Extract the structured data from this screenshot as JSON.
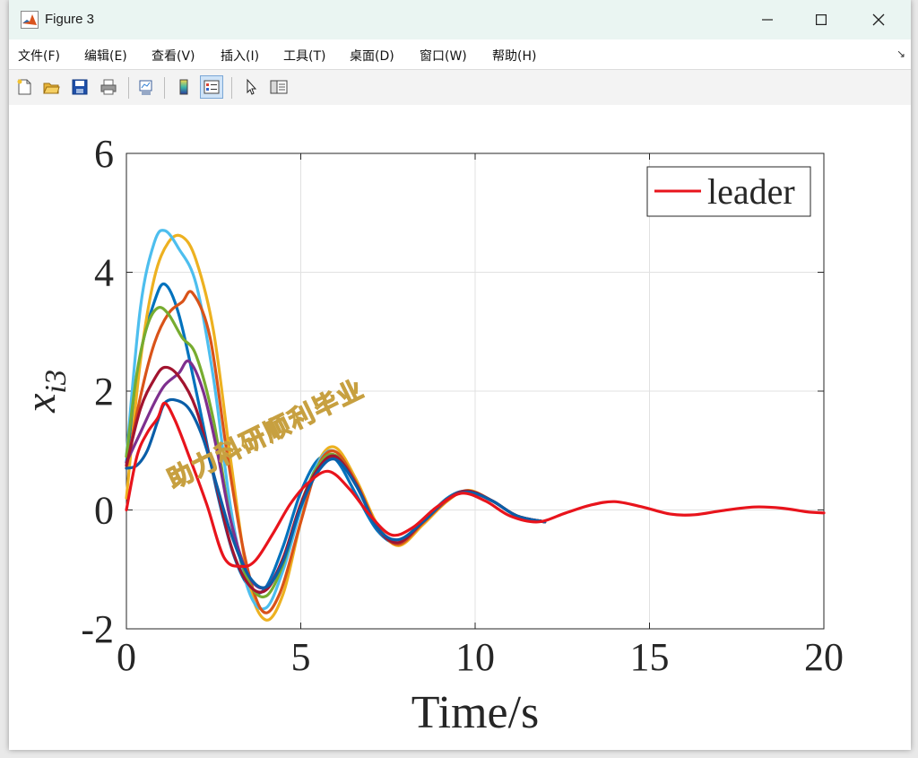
{
  "window": {
    "title": "Figure 3"
  },
  "menu": [
    {
      "label": "文件(F)"
    },
    {
      "label": "编辑(E)"
    },
    {
      "label": "查看(V)"
    },
    {
      "label": "插入(I)"
    },
    {
      "label": "工具(T)"
    },
    {
      "label": "桌面(D)"
    },
    {
      "label": "窗口(W)"
    },
    {
      "label": "帮助(H)"
    }
  ],
  "toolbar_icons": [
    "new-figure-icon",
    "open-file-icon",
    "save-icon",
    "print-icon",
    "link-plot-icon",
    "colorbar-icon",
    "legend-icon",
    "pointer-icon",
    "property-inspector-icon"
  ],
  "watermark": "助力科研顺利毕业",
  "chart_data": {
    "type": "line",
    "xlabel": "Time/s",
    "ylabel": "x_i3",
    "xlim": [
      0,
      20
    ],
    "ylim": [
      -2,
      6
    ],
    "xticks": [
      "0",
      "5",
      "10",
      "15",
      "20"
    ],
    "yticks": [
      "-2",
      "0",
      "2",
      "4",
      "6"
    ],
    "grid": true,
    "legend": {
      "position": "top-right",
      "entries": [
        "leader"
      ]
    },
    "series": [
      {
        "name": "leader",
        "color": "#e8141c",
        "x": [
          0,
          0.3,
          0.6,
          0.9,
          1.1,
          1.4,
          1.8,
          2.3,
          2.8,
          3.3,
          3.7,
          4.2,
          4.7,
          5.2,
          5.8,
          6.4,
          7.0,
          7.6,
          8.2,
          8.9,
          9.6,
          10.3,
          11.0,
          11.8,
          12.6,
          13.3,
          14.0,
          14.8,
          15.6,
          16.3,
          17.1,
          18.0,
          18.8,
          19.5,
          20
        ],
        "y": [
          0.0,
          0.9,
          1.3,
          1.55,
          1.8,
          1.5,
          0.9,
          0.1,
          -0.8,
          -0.95,
          -0.85,
          -0.4,
          0.1,
          0.45,
          0.65,
          0.35,
          -0.1,
          -0.42,
          -0.3,
          0.05,
          0.28,
          0.15,
          -0.1,
          -0.2,
          -0.05,
          0.08,
          0.14,
          0.05,
          -0.07,
          -0.08,
          -0.01,
          0.05,
          0.03,
          -0.03,
          -0.05
        ]
      },
      {
        "color": "#0072bd",
        "x": [
          0,
          0.4,
          0.8,
          1.1,
          1.5,
          2.0,
          2.6,
          3.1,
          3.6,
          4.0,
          4.5,
          5.0,
          5.5,
          6.0,
          6.6,
          7.2,
          7.8,
          8.5,
          9.2,
          9.8,
          10.5,
          11.2,
          12.0
        ],
        "y": [
          0.8,
          2.6,
          3.5,
          3.8,
          3.3,
          2.0,
          0.3,
          -0.8,
          -1.35,
          -1.3,
          -0.6,
          0.3,
          0.85,
          0.85,
          0.25,
          -0.35,
          -0.55,
          -0.2,
          0.2,
          0.32,
          0.15,
          -0.1,
          -0.2
        ]
      },
      {
        "color": "#edb120",
        "x": [
          0,
          0.4,
          0.8,
          1.2,
          1.6,
          2.0,
          2.5,
          3.0,
          3.5,
          4.0,
          4.5,
          5.0,
          5.5,
          6.0,
          6.6,
          7.2,
          7.8,
          8.5,
          9.2,
          9.8,
          10.5,
          11.2,
          12.0
        ],
        "y": [
          0.2,
          2.5,
          3.9,
          4.5,
          4.6,
          4.2,
          3.0,
          0.8,
          -1.2,
          -1.85,
          -1.4,
          -0.2,
          0.8,
          1.05,
          0.5,
          -0.25,
          -0.6,
          -0.25,
          0.15,
          0.33,
          0.15,
          -0.1,
          -0.2
        ]
      },
      {
        "color": "#4dbeee",
        "x": [
          0,
          0.4,
          0.8,
          1.1,
          1.5,
          2.0,
          2.5,
          3.0,
          3.5,
          4.0,
          4.5,
          5.0,
          5.5,
          6.0,
          6.6,
          7.2,
          7.8,
          8.5,
          9.2,
          9.8,
          10.5,
          11.2,
          12.0
        ],
        "y": [
          0.9,
          3.4,
          4.5,
          4.7,
          4.4,
          3.8,
          2.2,
          0.0,
          -1.35,
          -1.65,
          -1.0,
          0.0,
          0.8,
          0.98,
          0.45,
          -0.3,
          -0.55,
          -0.2,
          0.18,
          0.32,
          0.15,
          -0.1,
          -0.2
        ]
      },
      {
        "color": "#d95319",
        "x": [
          0,
          0.4,
          0.8,
          1.2,
          1.6,
          1.9,
          2.4,
          2.9,
          3.4,
          3.9,
          4.4,
          5.0,
          5.5,
          6.0,
          6.6,
          7.2,
          7.8,
          8.5,
          9.2,
          9.8,
          10.5,
          11.2,
          12.0
        ],
        "y": [
          0.7,
          1.9,
          2.8,
          3.3,
          3.5,
          3.65,
          2.9,
          0.9,
          -0.8,
          -1.7,
          -1.4,
          -0.2,
          0.75,
          0.98,
          0.45,
          -0.28,
          -0.58,
          -0.22,
          0.16,
          0.32,
          0.15,
          -0.1,
          -0.2
        ]
      },
      {
        "color": "#77ac30",
        "x": [
          0,
          0.3,
          0.6,
          0.9,
          1.2,
          1.6,
          2.0,
          2.5,
          3.0,
          3.5,
          4.0,
          4.5,
          5.0,
          5.5,
          6.0,
          6.6,
          7.2,
          7.8,
          8.5,
          9.2,
          9.8,
          10.5,
          11.2,
          12.0
        ],
        "y": [
          0.9,
          2.3,
          3.1,
          3.4,
          3.3,
          2.9,
          2.6,
          1.5,
          -0.2,
          -1.2,
          -1.45,
          -0.9,
          0.1,
          0.75,
          0.92,
          0.4,
          -0.3,
          -0.55,
          -0.2,
          0.18,
          0.32,
          0.15,
          -0.1,
          -0.2
        ]
      },
      {
        "color": "#7e2f8e",
        "x": [
          0,
          0.4,
          0.8,
          1.1,
          1.5,
          1.8,
          2.2,
          2.6,
          3.0,
          3.5,
          4.0,
          4.5,
          5.0,
          5.5,
          6.0,
          6.6,
          7.2,
          7.8,
          8.5,
          9.2,
          9.8,
          10.5,
          11.2,
          12.0
        ],
        "y": [
          0.8,
          1.3,
          1.8,
          2.1,
          2.3,
          2.5,
          2.0,
          1.0,
          -0.2,
          -1.1,
          -1.3,
          -0.8,
          0.1,
          0.7,
          0.9,
          0.4,
          -0.3,
          -0.55,
          -0.2,
          0.18,
          0.32,
          0.15,
          -0.1,
          -0.2
        ]
      },
      {
        "color": "#a2142f",
        "x": [
          0,
          0.4,
          0.8,
          1.1,
          1.5,
          2.0,
          2.5,
          3.0,
          3.5,
          4.0,
          4.5,
          5.0,
          5.5,
          6.0,
          6.6,
          7.2,
          7.8,
          8.5,
          9.2,
          9.8,
          10.5,
          11.2,
          12.0
        ],
        "y": [
          0.75,
          1.7,
          2.2,
          2.4,
          2.25,
          1.7,
          0.6,
          -0.6,
          -1.25,
          -1.35,
          -0.8,
          0.1,
          0.7,
          0.9,
          0.42,
          -0.3,
          -0.55,
          -0.2,
          0.18,
          0.32,
          0.15,
          -0.1,
          -0.2
        ]
      },
      {
        "color": "#0a5ea8",
        "x": [
          0,
          0.3,
          0.6,
          0.9,
          1.1,
          1.4,
          1.8,
          2.2,
          2.6,
          3.0,
          3.5,
          4.0,
          4.5,
          5.0,
          5.5,
          6.0,
          6.6,
          7.2,
          7.8,
          8.5,
          9.2,
          9.8,
          10.5,
          11.2,
          12.0
        ],
        "y": [
          0.7,
          0.75,
          1.0,
          1.5,
          1.8,
          1.85,
          1.7,
          1.2,
          0.4,
          -0.4,
          -1.1,
          -1.3,
          -0.85,
          0.05,
          0.65,
          0.85,
          0.4,
          -0.3,
          -0.5,
          -0.2,
          0.18,
          0.3,
          0.15,
          -0.1,
          -0.2
        ]
      }
    ]
  }
}
